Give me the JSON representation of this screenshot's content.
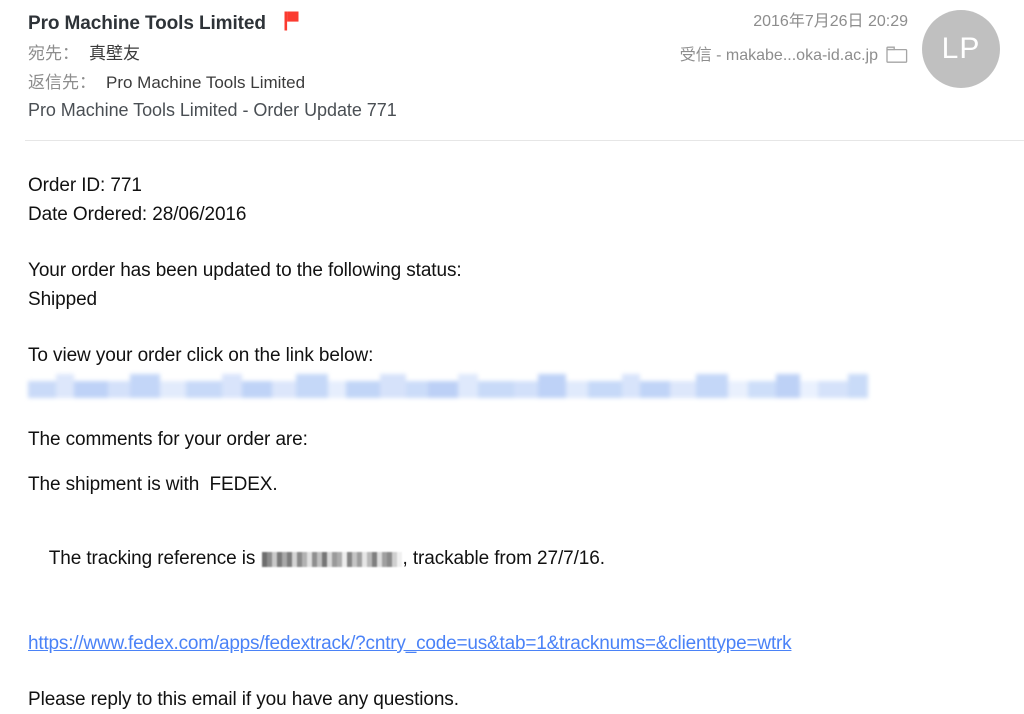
{
  "header": {
    "sender_name": "Pro Machine Tools Limited",
    "flag_icon": "flag-icon",
    "flag_color": "#FB3B30",
    "to_label": "宛先：",
    "to_value": "真壁友",
    "reply_to_label": "返信先：",
    "reply_to_value": "Pro Machine Tools Limited",
    "subject": "Pro Machine Tools Limited - Order Update 771",
    "date": "2016年7月26日 20:29",
    "mailbox": "受信 - makabe...oka-id.ac.jp",
    "folder_icon": "folder-icon",
    "avatar_initials": "LP",
    "avatar_color": "#C0C0C0"
  },
  "body": {
    "order_id_line": "Order ID: 771",
    "date_ordered_line": "Date Ordered: 28/06/2016",
    "status_intro": "Your order has been updated to the following status:",
    "status_value": "Shipped",
    "link_intro": "To view your order click on the link below:",
    "redacted_link_note": "[redacted link]",
    "comments_intro": "The comments for your order are:",
    "shipment_line": "The shipment is with  FEDEX.",
    "tracking_prefix": "The tracking reference is ",
    "tracking_redacted_note": "[redacted tracking number]",
    "tracking_suffix": ", trackable from 27/7/16.",
    "fedex_url": "https://www.fedex.com/apps/fedextrack/?cntry_code=us&tab=1&tracknums=&clienttype=wtrk",
    "closing_line": "Please reply to this email if you have any questions."
  }
}
